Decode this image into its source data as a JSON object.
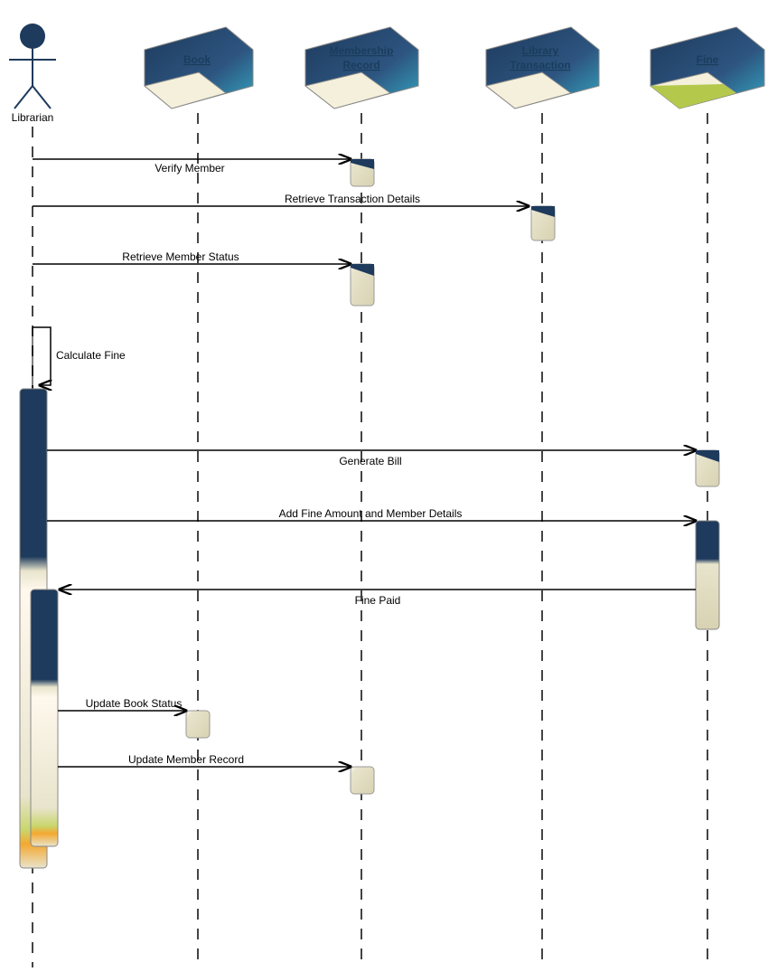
{
  "actor": {
    "name": "Librarian"
  },
  "participants": {
    "p1": "Book",
    "p2_line1": "Membership",
    "p2_line2": "Record",
    "p3_line1": "Library",
    "p3_line2": "Transaction",
    "p4": "Fine"
  },
  "messages": {
    "m1": "Verify Member",
    "m2": "Retrieve Transaction Details",
    "m3": "Retrieve Member Status",
    "m4": "Calculate Fine",
    "m5": "Generate Bill",
    "m6": "Add Fine Amount and Member Details",
    "m7": "Fine Paid",
    "m8": "Update Book Status",
    "m9": "Update Member Record"
  },
  "chart_data": {
    "type": "sequence-diagram",
    "actors": [
      {
        "name": "Librarian",
        "type": "actor"
      },
      {
        "name": "Book",
        "type": "object"
      },
      {
        "name": "Membership Record",
        "type": "object"
      },
      {
        "name": "Library Transaction",
        "type": "object"
      },
      {
        "name": "Fine",
        "type": "object"
      }
    ],
    "messages": [
      {
        "from": "Librarian",
        "to": "Membership Record",
        "label": "Verify Member"
      },
      {
        "from": "Librarian",
        "to": "Library Transaction",
        "label": "Retrieve Transaction Details"
      },
      {
        "from": "Librarian",
        "to": "Membership Record",
        "label": "Retrieve Member Status"
      },
      {
        "from": "Librarian",
        "to": "Librarian",
        "label": "Calculate Fine",
        "self": true
      },
      {
        "from": "Librarian",
        "to": "Fine",
        "label": "Generate Bill"
      },
      {
        "from": "Librarian",
        "to": "Fine",
        "label": "Add Fine Amount and Member Details"
      },
      {
        "from": "Fine",
        "to": "Librarian",
        "label": "Fine Paid"
      },
      {
        "from": "Librarian",
        "to": "Book",
        "label": "Update Book Status"
      },
      {
        "from": "Librarian",
        "to": "Membership Record",
        "label": "Update Member Record"
      }
    ]
  }
}
